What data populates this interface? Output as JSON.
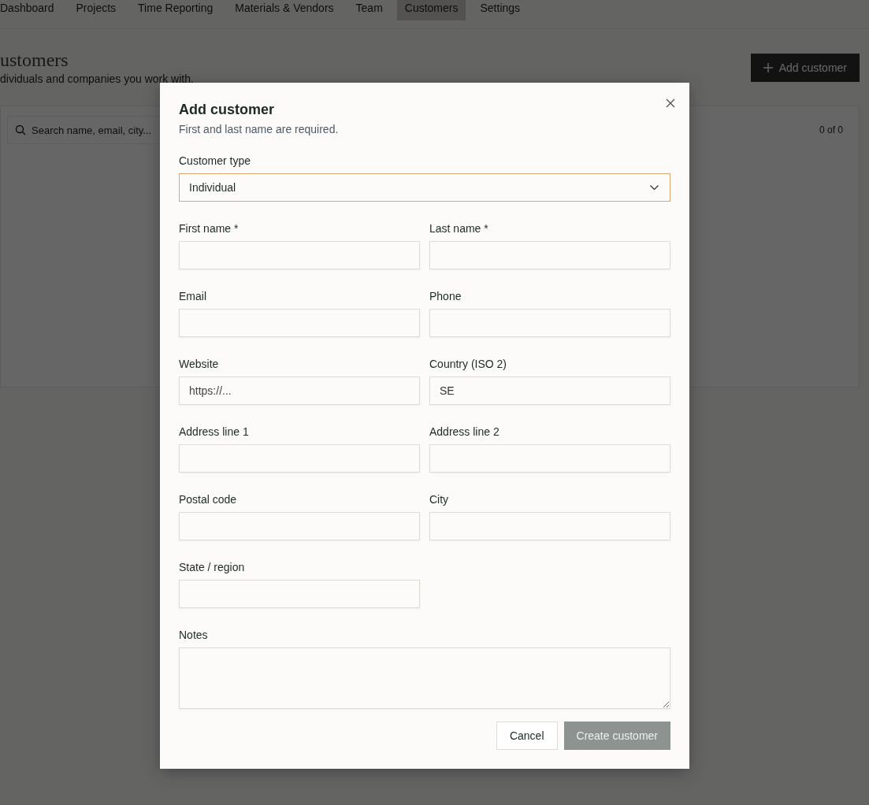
{
  "nav": {
    "items": [
      {
        "label": "Dashboard",
        "selected": false
      },
      {
        "label": "Projects",
        "selected": false
      },
      {
        "label": "Time Reporting",
        "selected": false
      },
      {
        "label": "Materials & Vendors",
        "selected": false
      },
      {
        "label": "Team",
        "selected": false
      },
      {
        "label": "Customers",
        "selected": true
      },
      {
        "label": "Settings",
        "selected": false
      }
    ]
  },
  "page": {
    "title": "ustomers",
    "subtitle": "dividuals and companies you work with.",
    "add_button": "Add customer",
    "search": {
      "placeholder": "Search name, email, city..."
    },
    "count": "0 of 0"
  },
  "dialog": {
    "title": "Add customer",
    "subtitle": "First and last name are required.",
    "fields": [
      {
        "kind": "select",
        "label": "Customer type",
        "value": "Individual",
        "focused": true
      },
      {
        "kind": "text",
        "label": "First name *"
      },
      {
        "kind": "text",
        "label": "Last name *"
      },
      {
        "kind": "text",
        "label": "Email"
      },
      {
        "kind": "text",
        "label": "Phone"
      },
      {
        "kind": "text",
        "label": "Website",
        "placeholder": "https://..."
      },
      {
        "kind": "text",
        "label": "Country (ISO 2)",
        "value": "SE"
      },
      {
        "kind": "text",
        "label": "Address line 1"
      },
      {
        "kind": "text",
        "label": "Address line 2"
      },
      {
        "kind": "text",
        "label": "Postal code"
      },
      {
        "kind": "text",
        "label": "City"
      },
      {
        "kind": "text",
        "label": "State / region"
      },
      {
        "kind": "textarea",
        "label": "Notes"
      }
    ],
    "cancel": "Cancel",
    "submit": {
      "label": "Create customer",
      "disabled": true
    }
  }
}
